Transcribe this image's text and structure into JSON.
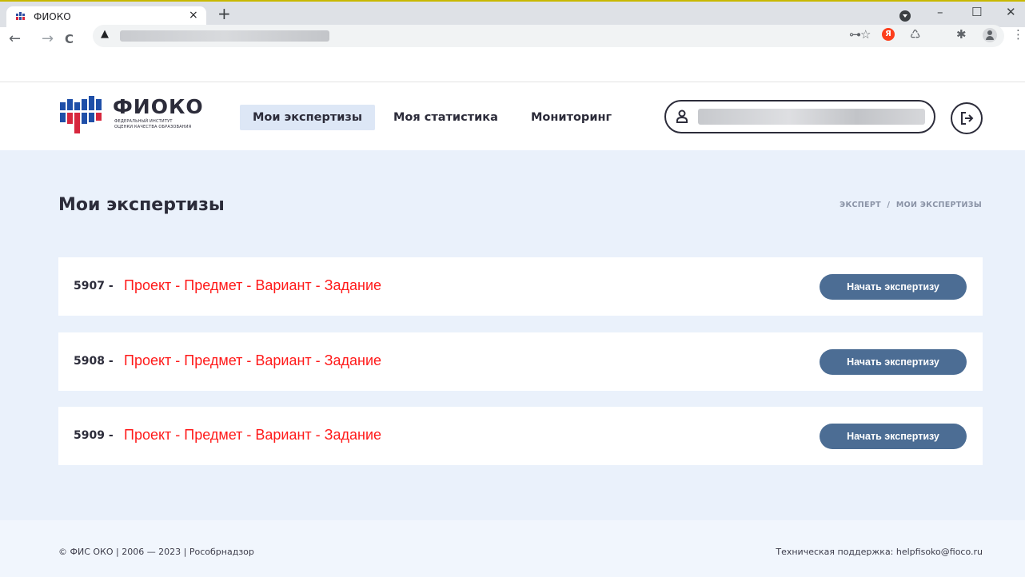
{
  "browser": {
    "tab_title": "ФИОКО",
    "tab_close": "×",
    "new_tab": "+",
    "back": "←",
    "forward": "→",
    "reload": "C",
    "warning": "▲",
    "minimize": "–",
    "maximize": "☐",
    "close": "✕",
    "key_icon": "⊶",
    "star_icon": "☆",
    "yandex_letter": "Я",
    "recycle_icon": "♺",
    "puzzle_icon": "✱",
    "menu_icon": "⋮"
  },
  "header": {
    "logo_title": "ФИОКО",
    "logo_sub_line1": "ФЕДЕРАЛЬНЫЙ ИНСТИТУТ",
    "logo_sub_line2": "ОЦЕНКИ КАЧЕСТВА ОБРАЗОВАНИЯ",
    "nav": [
      {
        "label": "Мои экспертизы",
        "active": true
      },
      {
        "label": "Моя статистика",
        "active": false
      },
      {
        "label": "Мониторинг",
        "active": false
      }
    ]
  },
  "main": {
    "title": "Мои экспертизы",
    "breadcrumb": [
      "ЭКСПЕРТ",
      "/",
      "МОИ ЭКСПЕРТИЗЫ"
    ],
    "items": [
      {
        "number": "5907 -",
        "title": "Проект - Предмет - Вариант - Задание",
        "button": "Начать экспертизу"
      },
      {
        "number": "5908 -",
        "title": "Проект - Предмет - Вариант - Задание",
        "button": "Начать экспертизу"
      },
      {
        "number": "5909 -",
        "title": "Проект - Предмет - Вариант - Задание",
        "button": "Начать экспертизу"
      }
    ]
  },
  "footer": {
    "left": "© ФИС ОКО | 2006 — 2023 | Рособрнадзор",
    "right": "Техническая поддержка: helpfisoko@fioco.ru"
  },
  "colors": {
    "accent_button": "#4c6d94",
    "task_title": "#ff1a1a",
    "main_bg": "#eaf1fb",
    "nav_active_bg": "#dde7f6"
  }
}
